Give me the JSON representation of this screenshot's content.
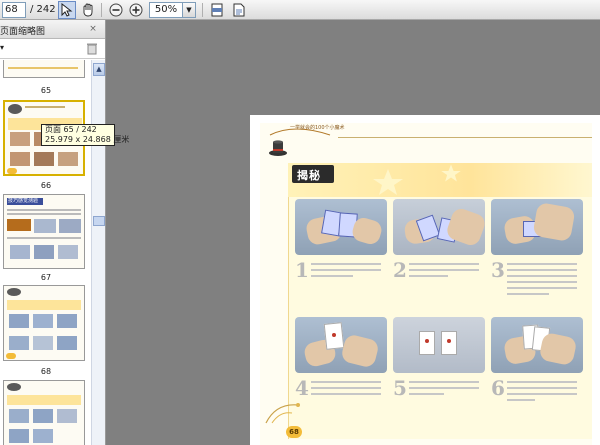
{
  "toolbar": {
    "current_page": "68",
    "total_pages": "/ 242",
    "zoom": "50%",
    "icons": [
      "select-icon",
      "hand-icon",
      "zoom-out-icon",
      "zoom-in-icon",
      "fit-page-icon",
      "fit-width-icon"
    ]
  },
  "sidebar": {
    "title": "页面缩略图",
    "close": "×",
    "options": "▾",
    "pages": [
      {
        "label": "65"
      },
      {
        "label": "66"
      },
      {
        "label": "67"
      },
      {
        "label": "68"
      }
    ],
    "thumb_heading": "技巧感觉测验",
    "tooltip": {
      "line1": "页面 65 / 242",
      "line2": "25.979 x 24.868 厘米"
    }
  },
  "document": {
    "brand": "一学就会的100个小魔术",
    "section_title": "揭秘",
    "page_number": "68",
    "accent_color": "#f3bc39",
    "steps": [
      {
        "num": "1"
      },
      {
        "num": "2"
      },
      {
        "num": "3"
      },
      {
        "num": "4"
      },
      {
        "num": "5"
      },
      {
        "num": "6"
      }
    ]
  }
}
